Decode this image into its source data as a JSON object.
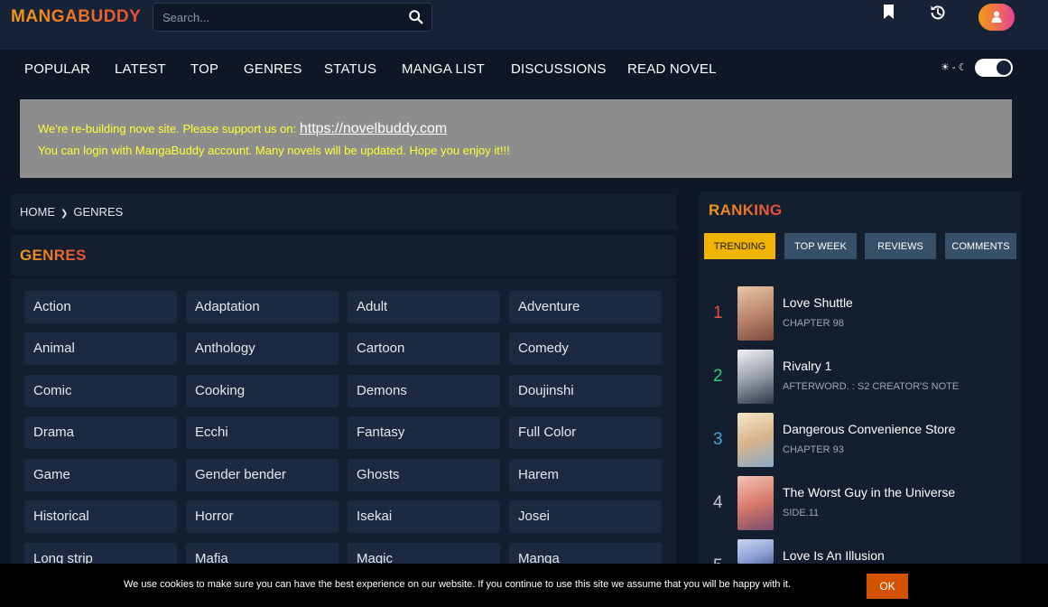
{
  "header": {
    "logo": "MANGABUDDY",
    "search_placeholder": "Search..."
  },
  "nav": {
    "items": [
      "POPULAR",
      "LATEST",
      "TOP",
      "GENRES",
      "STATUS",
      "MANGA LIST",
      "DISCUSSIONS",
      "READ NOVEL"
    ],
    "theme_label": "☀ - ☾"
  },
  "notice": {
    "line1_prefix": "We're re-building nove site. Please support us on: ",
    "line1_link": "https://novelbuddy.com",
    "line2": "You can login with MangaBuddy account. Many novels will be updated. Hope you enjoy it!!!"
  },
  "breadcrumb": {
    "home": "HOME",
    "current": "GENRES"
  },
  "genres": {
    "title": "GENRES",
    "items": [
      "Action",
      "Adaptation",
      "Adult",
      "Adventure",
      "Animal",
      "Anthology",
      "Cartoon",
      "Comedy",
      "Comic",
      "Cooking",
      "Demons",
      "Doujinshi",
      "Drama",
      "Ecchi",
      "Fantasy",
      "Full Color",
      "Game",
      "Gender bender",
      "Ghosts",
      "Harem",
      "Historical",
      "Horror",
      "Isekai",
      "Josei",
      "Long strip",
      "Mafia",
      "Magic",
      "Manga"
    ]
  },
  "ranking": {
    "title": "RANKING",
    "tabs": [
      "TRENDING",
      "TOP WEEK",
      "REVIEWS",
      "COMMENTS"
    ],
    "active_tab": "TRENDING",
    "entries": [
      {
        "rank": "1",
        "title": "Love Shuttle",
        "sub": "CHAPTER 98",
        "color": "#e74c3c"
      },
      {
        "rank": "2",
        "title": "Rivalry 1",
        "sub": "AFTERWORD. : S2 CREATOR'S NOTE",
        "color": "#2ecc71"
      },
      {
        "rank": "3",
        "title": "Dangerous Convenience Store",
        "sub": "CHAPTER 93",
        "color": "#3fa9d4"
      },
      {
        "rank": "4",
        "title": "The Worst Guy in the Universe",
        "sub": "SIDE.11",
        "color": "#c0c7d0"
      },
      {
        "rank": "5",
        "title": "Love Is An Illusion",
        "sub": "",
        "color": "#c0c7d0"
      }
    ]
  },
  "cookie": {
    "message": "We use cookies to make sure you can have the best experience on our website. If you continue to use this site we assume that you will be happy with it.",
    "ok_label": "OK"
  }
}
